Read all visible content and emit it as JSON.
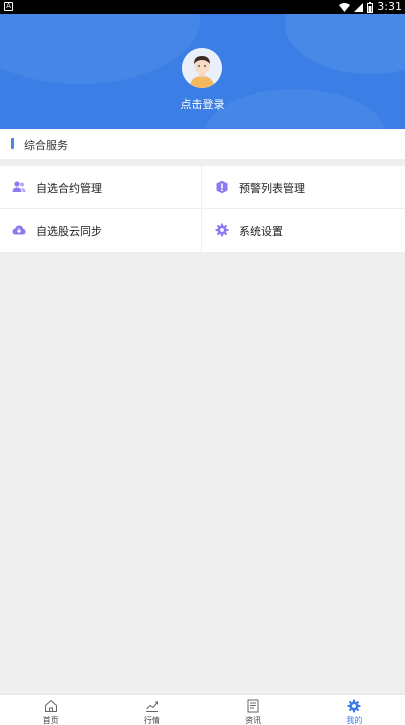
{
  "status_bar": {
    "notification_icon": "A",
    "time": "3:31"
  },
  "header": {
    "login_text": "点击登录"
  },
  "services": {
    "section_title": "综合服务",
    "items": [
      {
        "label": "自选合约管理",
        "icon": "users-icon"
      },
      {
        "label": "预警列表管理",
        "icon": "alert-icon"
      },
      {
        "label": "自选股云同步",
        "icon": "cloud-download-icon"
      },
      {
        "label": "系统设置",
        "icon": "gear-icon"
      }
    ]
  },
  "tabbar": {
    "tabs": [
      {
        "label": "首页",
        "icon": "home-icon"
      },
      {
        "label": "行情",
        "icon": "chart-icon"
      },
      {
        "label": "资讯",
        "icon": "news-icon"
      },
      {
        "label": "我的",
        "icon": "gear-icon",
        "active": true
      }
    ]
  },
  "colors": {
    "primary": "#3b7fe6",
    "icon_purple": "#8a7cf0",
    "background": "#efefef"
  }
}
